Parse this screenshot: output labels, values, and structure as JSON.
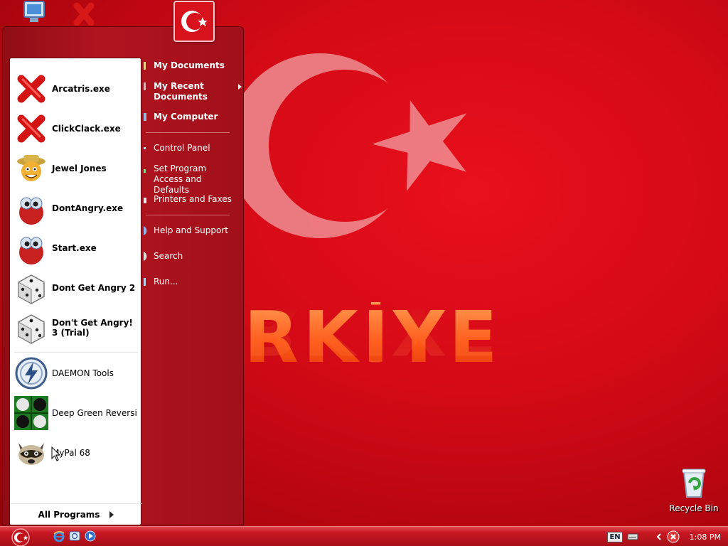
{
  "desktop": {
    "icons": [
      {
        "name": "my-computer",
        "label": ""
      },
      {
        "name": "program",
        "label": ""
      },
      {
        "name": "recycle-bin",
        "label": "Recycle Bin"
      }
    ],
    "wallpaper_text": "JRKİYE"
  },
  "start_menu": {
    "pinned": [
      {
        "label": "Arcatris.exe",
        "icon": "red-x-icon"
      },
      {
        "label": "ClickClack.exe",
        "icon": "red-x-icon"
      },
      {
        "label": "Jewel Jones",
        "icon": "jewel-jones-icon"
      },
      {
        "label": "DontAngry.exe",
        "icon": "red-face-icon"
      },
      {
        "label": "Start.exe",
        "icon": "red-face-icon"
      },
      {
        "label": "Dont Get Angry 2",
        "icon": "dice-icon"
      },
      {
        "label": "Don't Get Angry! 3 (Trial)",
        "icon": "dice-icon"
      }
    ],
    "recent": [
      {
        "label": "DAEMON Tools",
        "icon": "daemon-tools-icon"
      },
      {
        "label": "Deep Green Reversi",
        "icon": "reversi-icon"
      },
      {
        "label": "MyPal 68",
        "icon": "raccoon-icon"
      }
    ],
    "all_programs": "All Programs",
    "right": [
      {
        "label": "My Documents",
        "bold": true
      },
      {
        "label": "My Recent Documents",
        "bold": true,
        "submenu": true
      },
      {
        "label": "My Computer",
        "bold": true
      },
      {
        "label": "Control Panel",
        "bold": false
      },
      {
        "label": "Set Program Access and Defaults",
        "bold": false
      },
      {
        "label": "Printers and Faxes",
        "bold": false
      },
      {
        "label": "Help and Support",
        "bold": false
      },
      {
        "label": "Search",
        "bold": false
      },
      {
        "label": "Run...",
        "bold": false
      }
    ]
  },
  "taskbar": {
    "language": "EN",
    "clock": "1:08 PM"
  },
  "colors": {
    "accent": "#c71822",
    "flag_red": "#e30a17",
    "white": "#ffffff"
  }
}
